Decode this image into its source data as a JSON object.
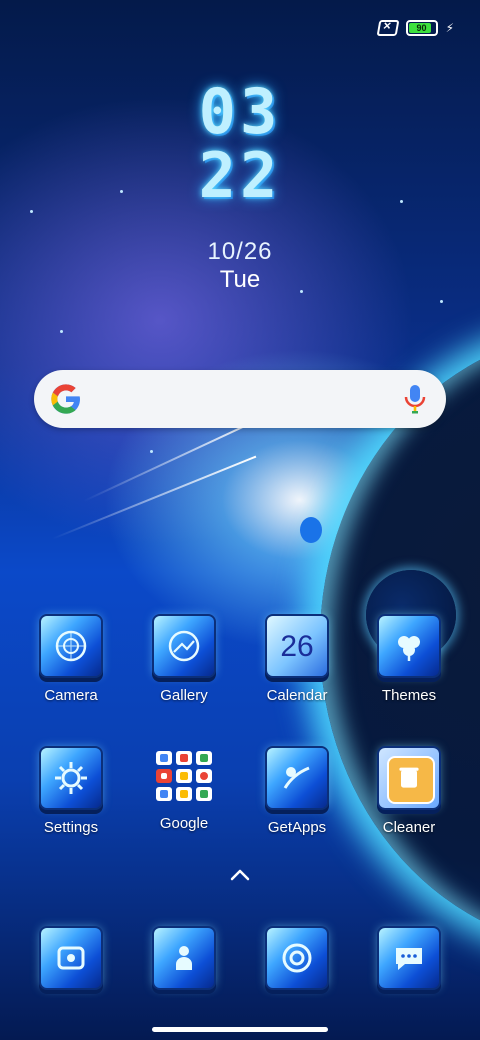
{
  "status_bar": {
    "battery_level": "90",
    "icons": [
      "no-sim-icon",
      "battery-icon",
      "charging-bolt-icon"
    ]
  },
  "clock_widget": {
    "hours": "03",
    "minutes": "22",
    "date": "10/26",
    "day": "Tue"
  },
  "search_bar": {
    "icons": [
      "google-g-icon",
      "microphone-icon"
    ]
  },
  "home_apps": [
    {
      "label": "Camera",
      "icon": "camera-icon"
    },
    {
      "label": "Gallery",
      "icon": "gallery-icon"
    },
    {
      "label": "Calendar",
      "icon": "calendar-icon",
      "badge": "26"
    },
    {
      "label": "Themes",
      "icon": "themes-icon"
    },
    {
      "label": "Settings",
      "icon": "settings-icon"
    },
    {
      "label": "Google",
      "icon": "google-folder-icon"
    },
    {
      "label": "GetApps",
      "icon": "getapps-icon"
    },
    {
      "label": "Cleaner",
      "icon": "cleaner-icon"
    }
  ],
  "dock": {
    "icons": [
      "phone-icon",
      "contacts-icon",
      "browser-icon",
      "messages-icon"
    ]
  },
  "colors": {
    "accent_cyan": "#5fe0ff",
    "google_blue": "#4285f4",
    "google_red": "#ea4335",
    "google_yellow": "#fbbc05",
    "google_green": "#34a853",
    "battery_green": "#3ee13e"
  }
}
